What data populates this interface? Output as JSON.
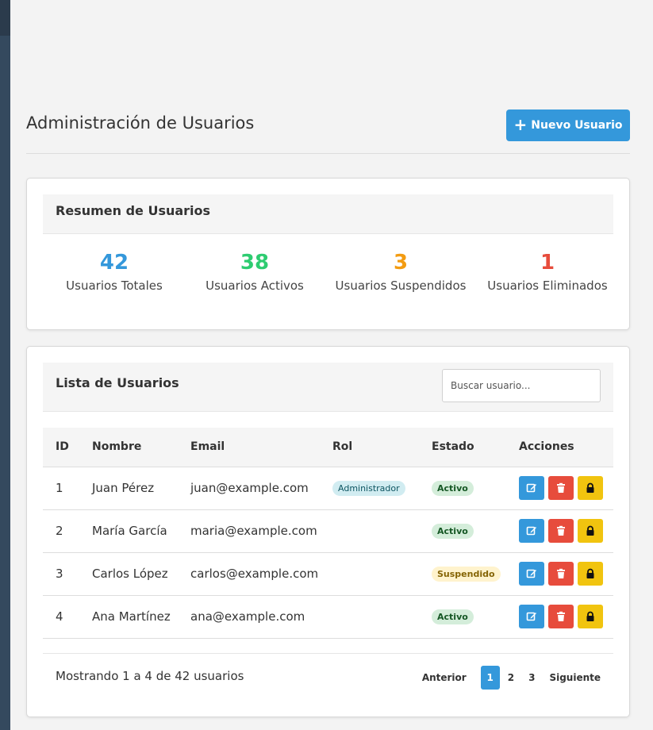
{
  "header": {
    "title": "Administración de Usuarios",
    "new_user_label": "Nuevo Usuario",
    "new_user_icon": "plus-icon"
  },
  "summary": {
    "title": "Resumen de Usuarios",
    "stats": [
      {
        "value": "42",
        "label": "Usuarios Totales",
        "color": "#3498db"
      },
      {
        "value": "38",
        "label": "Usuarios Activos",
        "color": "#2ecc71"
      },
      {
        "value": "3",
        "label": "Usuarios Suspendidos",
        "color": "#f39c12"
      },
      {
        "value": "1",
        "label": "Usuarios Eliminados",
        "color": "#e74c3c"
      }
    ]
  },
  "user_list": {
    "title": "Lista de Usuarios",
    "search_placeholder": "Buscar usuario...",
    "columns": [
      "ID",
      "Nombre",
      "Email",
      "Rol",
      "Estado",
      "Acciones"
    ],
    "rows": [
      {
        "id": "1",
        "name": "Juan Pérez",
        "email": "juan@example.com",
        "role": "Administrador",
        "status": "Activo"
      },
      {
        "id": "2",
        "name": "María García",
        "email": "maria@example.com",
        "role": "",
        "status": "Activo"
      },
      {
        "id": "3",
        "name": "Carlos López",
        "email": "carlos@example.com",
        "role": "",
        "status": "Suspendido"
      },
      {
        "id": "4",
        "name": "Ana Martínez",
        "email": "ana@example.com",
        "role": "",
        "status": "Activo"
      }
    ],
    "action_icons": [
      "edit-icon",
      "trash-icon",
      "lock-icon"
    ],
    "footer_text": "Mostrando 1 a 4 de 42 usuarios",
    "pagination": {
      "prev_label": "Anterior",
      "pages": [
        "1",
        "2",
        "3"
      ],
      "current_page": "1",
      "next_label": "Siguiente"
    }
  },
  "colors": {
    "accent": "#3498db",
    "success": "#2ecc71",
    "warning": "#f39c12",
    "danger": "#e74c3c",
    "lock": "#f1c40f",
    "sidebar": "#34495e"
  }
}
